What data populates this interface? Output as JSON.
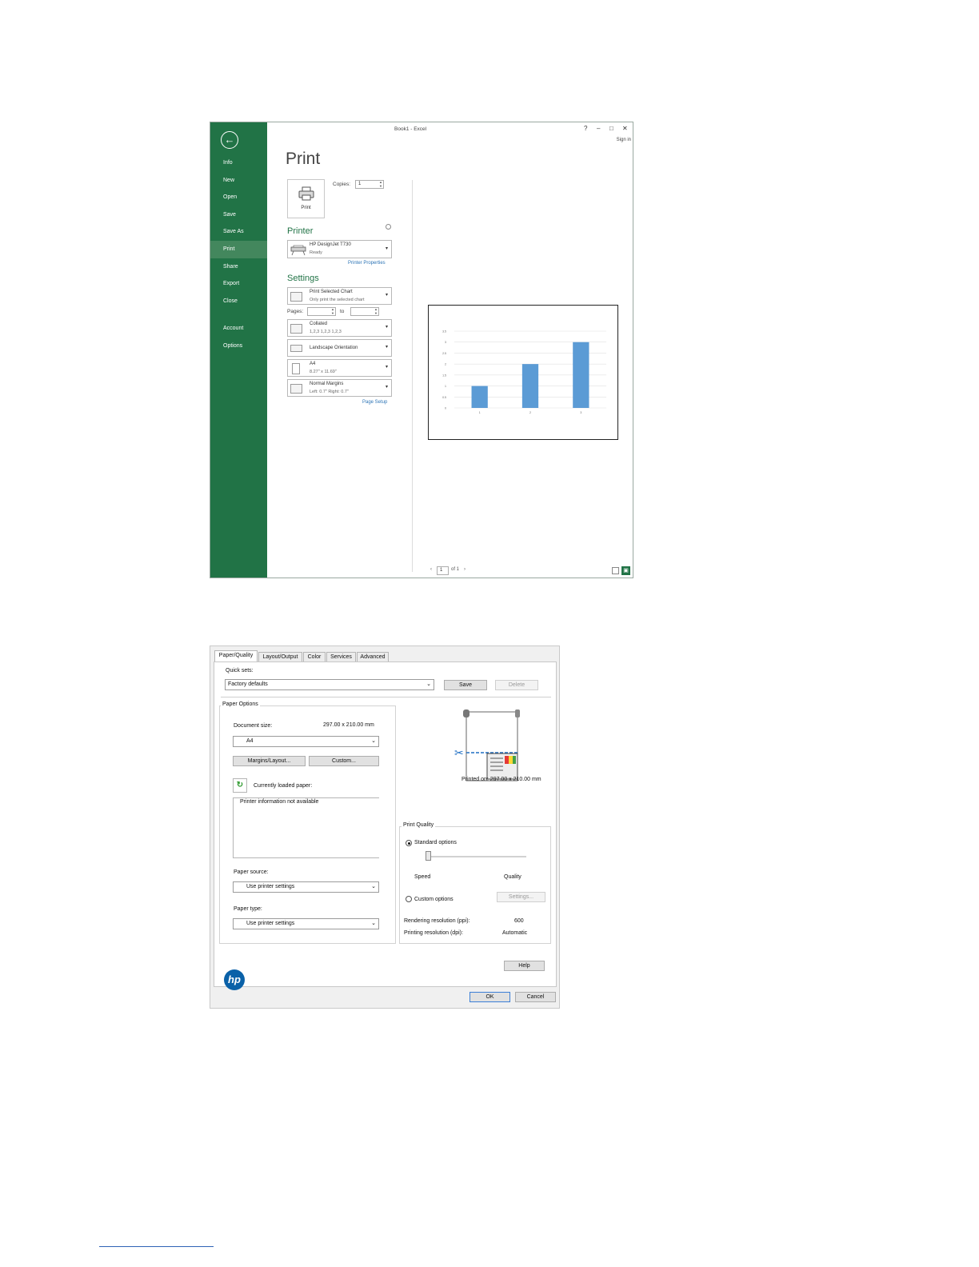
{
  "excel": {
    "window_title": "Book1 - Excel",
    "window_controls": [
      "?",
      "–",
      "□",
      "✕"
    ],
    "sign_in": "Sign in",
    "back_icon": "back-arrow-icon",
    "nav": [
      "Info",
      "New",
      "Open",
      "Save",
      "Save As",
      "Print",
      "Share",
      "Export",
      "Close",
      "Account",
      "Options"
    ],
    "selected_nav": "Print",
    "heading": "Print",
    "print_button_label": "Print",
    "copies_label": "Copies:",
    "copies_value": "1",
    "printer_heading": "Printer",
    "printer_name": "HP DesignJet T730",
    "printer_status": "Ready",
    "printer_properties_link": "Printer Properties",
    "settings_heading": "Settings",
    "settings": {
      "scope_title": "Print Selected Chart",
      "scope_sub": "Only print the selected chart",
      "pages_label": "Pages:",
      "pages_to": "to",
      "collate_title": "Collated",
      "collate_sub": "1,2,3    1,2,3    1,2,3",
      "orientation": "Landscape Orientation",
      "paper_title": "A4",
      "paper_sub": "8.27\" x 11.69\"",
      "margins_title": "Normal Margins",
      "margins_sub": "Left:  0.7\"    Right:  0.7\""
    },
    "page_setup_link": "Page Setup",
    "page_nav": {
      "current": "1",
      "of": "of 1"
    },
    "accent_color": "#217346"
  },
  "chart_data": {
    "type": "bar",
    "categories": [
      "1",
      "2",
      "3"
    ],
    "values": [
      1,
      2,
      3
    ],
    "yticks": [
      "0",
      "0.5",
      "1",
      "1.5",
      "2",
      "2.5",
      "3",
      "3.5"
    ],
    "ylim": [
      0,
      3.5
    ],
    "grid": true,
    "bar_color": "#5b9bd5"
  },
  "hp": {
    "tabs": [
      "Paper/Quality",
      "Layout/Output",
      "Color",
      "Services",
      "Advanced"
    ],
    "selected_tab": "Paper/Quality",
    "quick_sets_label": "Quick sets:",
    "quick_sets_value": "Factory defaults",
    "save": "Save",
    "delete": "Delete",
    "paper_options": "Paper Options",
    "document_size_label": "Document size:",
    "document_size_value": "297.00 x 210.00 mm",
    "document_size_select": "A4",
    "margins_button": "Margins/Layout...",
    "custom_button": "Custom...",
    "currently_loaded": "Currently loaded paper:",
    "printer_info": "Printer information not available",
    "paper_source_label": "Paper source:",
    "paper_source_value": "Use printer settings",
    "paper_type_label": "Paper type:",
    "paper_type_value": "Use printer settings",
    "printed_on": "Printed on: 297.00 x 210.00 mm",
    "print_quality": "Print Quality",
    "standard_options": "Standard options",
    "speed": "Speed",
    "quality": "Quality",
    "quality_level": 0,
    "custom_options": "Custom options",
    "settings_button": "Settings...",
    "rendering_label": "Rendering resolution (ppi):",
    "rendering_value": "600",
    "printing_label": "Printing resolution (dpi):",
    "printing_value": "Automatic",
    "logo_text": "hp",
    "help": "Help",
    "ok": "OK",
    "cancel": "Cancel"
  }
}
